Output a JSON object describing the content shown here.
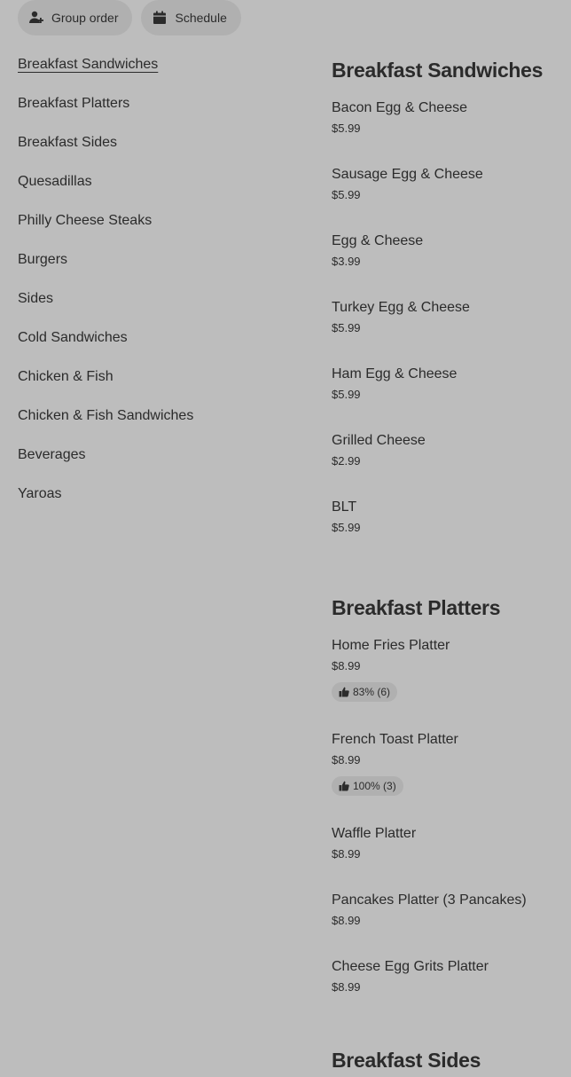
{
  "actions": {
    "group_order": "Group order",
    "schedule": "Schedule"
  },
  "nav": [
    "Breakfast Sandwiches",
    "Breakfast Platters",
    "Breakfast Sides",
    "Quesadillas",
    "Philly Cheese Steaks",
    "Burgers",
    "Sides",
    "Cold Sandwiches",
    "Chicken & Fish",
    "Chicken & Fish Sandwiches",
    "Beverages",
    "Yaroas"
  ],
  "sections": [
    {
      "title": "Breakfast Sandwiches",
      "items": [
        {
          "name": "Bacon Egg & Cheese",
          "price": "$5.99"
        },
        {
          "name": "Sausage Egg & Cheese",
          "price": "$5.99"
        },
        {
          "name": "Egg & Cheese",
          "price": "$3.99"
        },
        {
          "name": "Turkey Egg & Cheese",
          "price": "$5.99"
        },
        {
          "name": "Ham Egg & Cheese",
          "price": "$5.99"
        },
        {
          "name": "Grilled Cheese",
          "price": "$2.99"
        },
        {
          "name": "BLT",
          "price": "$5.99"
        }
      ]
    },
    {
      "title": "Breakfast Platters",
      "items": [
        {
          "name": "Home Fries Platter",
          "price": "$8.99",
          "rating": "83% (6)"
        },
        {
          "name": "French Toast Platter",
          "price": "$8.99",
          "rating": "100% (3)"
        },
        {
          "name": "Waffle Platter",
          "price": "$8.99"
        },
        {
          "name": "Pancakes Platter (3 Pancakes)",
          "price": "$8.99"
        },
        {
          "name": "Cheese Egg Grits Platter",
          "price": "$8.99"
        }
      ]
    },
    {
      "title": "Breakfast Sides",
      "items": []
    }
  ]
}
